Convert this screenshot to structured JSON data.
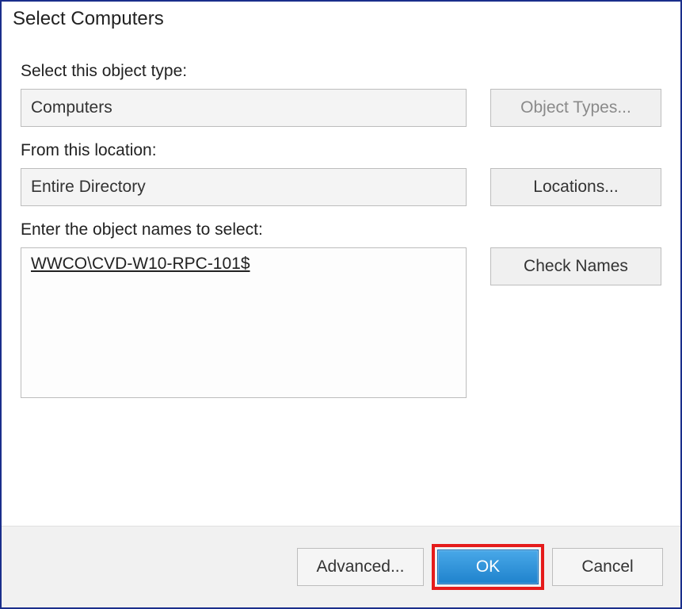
{
  "dialog": {
    "title": "Select Computers"
  },
  "object_type": {
    "label": "Select this object type:",
    "value": "Computers",
    "button": "Object Types..."
  },
  "location": {
    "label": "From this location:",
    "value": "Entire Directory",
    "button": "Locations..."
  },
  "names": {
    "label": "Enter the object names to select:",
    "value": "WWCO\\CVD-W10-RPC-101$",
    "button": "Check Names"
  },
  "footer": {
    "advanced": "Advanced...",
    "ok": "OK",
    "cancel": "Cancel"
  }
}
